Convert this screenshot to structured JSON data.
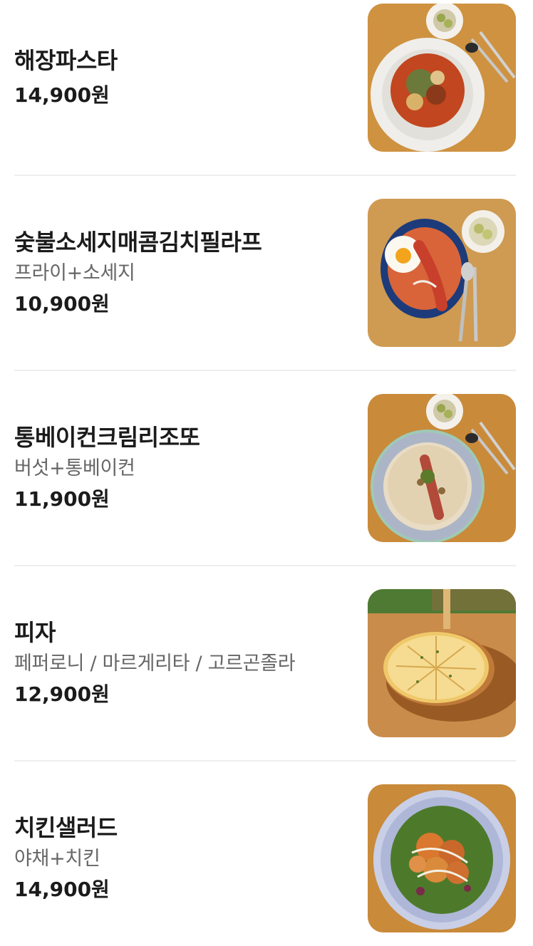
{
  "menu": {
    "items": [
      {
        "name": "해장파스타",
        "desc": "",
        "price": "14,900원",
        "image": "pasta-photo"
      },
      {
        "name": "숯불소세지매콤김치필라프",
        "desc": "프라이+소세지",
        "price": "10,900원",
        "image": "kimchi-pilaf-photo"
      },
      {
        "name": "통베이컨크림리조또",
        "desc": "버섯+통베이컨",
        "price": "11,900원",
        "image": "cream-risotto-photo"
      },
      {
        "name": "피자",
        "desc": "페퍼로니 / 마르게리타 / 고르곤졸라",
        "price": "12,900원",
        "image": "pizza-photo"
      },
      {
        "name": "치킨샐러드",
        "desc": "야채+치킨",
        "price": "14,900원",
        "image": "chicken-salad-photo"
      }
    ]
  }
}
